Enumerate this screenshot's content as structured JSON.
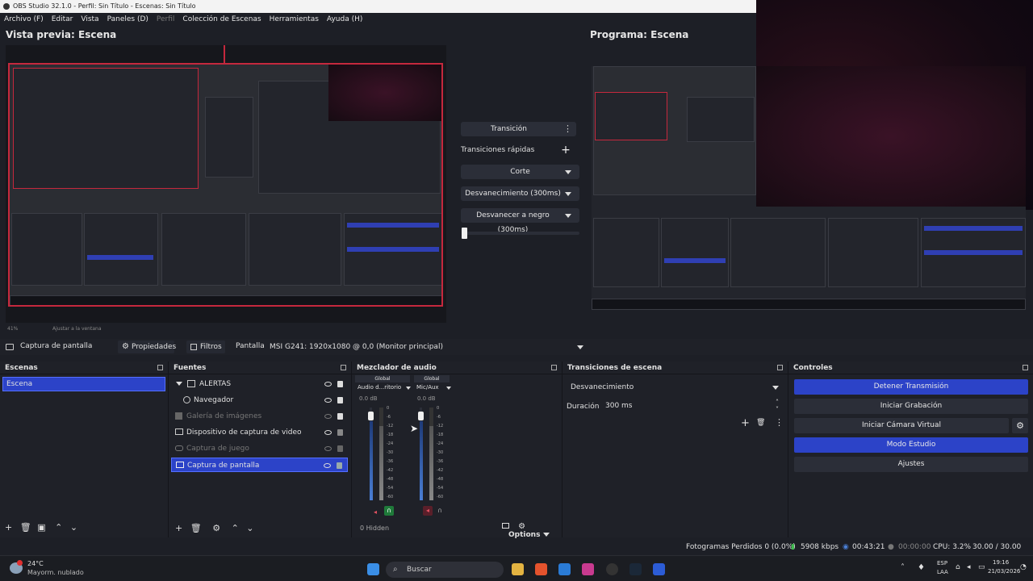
{
  "window": {
    "title": "OBS Studio 32.1.0 - Perfil: Sin Título - Escenas: Sin Título"
  },
  "menu": [
    {
      "label": "Archivo (F)",
      "dim": false
    },
    {
      "label": "Editar",
      "dim": false
    },
    {
      "label": "Vista",
      "dim": false
    },
    {
      "label": "Paneles (D)",
      "dim": false
    },
    {
      "label": "Perfil",
      "dim": true
    },
    {
      "label": "Colección de Escenas",
      "dim": false
    },
    {
      "label": "Herramientas",
      "dim": false
    },
    {
      "label": "Ayuda (H)",
      "dim": false
    }
  ],
  "preview": {
    "title": "Vista previa: Escena",
    "zoom": "41%",
    "fit": "Ajustar a la ventana"
  },
  "program": {
    "title": "Programa: Escena"
  },
  "transitions_center": {
    "transition_label": "Transición",
    "quick_label": "Transiciones rápidas",
    "items": [
      "Corte",
      "Desvanecimiento (300ms)",
      "Desvanecer a negro (300ms)"
    ],
    "tbar_value": 0
  },
  "source_toolbar": {
    "source": "Captura de pantalla",
    "properties": "Propiedades",
    "filters": "Filtros",
    "display_label": "Pantalla",
    "display_value": "MSI G241: 1920x1080 @ 0,0 (Monitor principal)"
  },
  "scenes": {
    "title": "Escenas",
    "items": [
      {
        "label": "Escena",
        "selected": true
      }
    ]
  },
  "sources": {
    "title": "Fuentes",
    "items": [
      {
        "label": "ALERTAS",
        "kind": "group",
        "visible": true,
        "locked": true,
        "selected": false
      },
      {
        "label": "Navegador",
        "kind": "browser",
        "visible": true,
        "locked": true,
        "selected": false
      },
      {
        "label": "Galería de imágenes",
        "kind": "image",
        "visible": false,
        "locked": true,
        "selected": false
      },
      {
        "label": "Dispositivo de captura de video",
        "kind": "camera",
        "visible": true,
        "locked": false,
        "selected": false
      },
      {
        "label": "Captura de juego",
        "kind": "game",
        "visible": false,
        "locked": false,
        "selected": false
      },
      {
        "label": "Captura de pantalla",
        "kind": "display",
        "visible": true,
        "locked": false,
        "selected": true
      }
    ]
  },
  "mixer": {
    "title": "Mezclador de audio",
    "channels": [
      {
        "global": "Global",
        "name": "Audio d...ritorio",
        "db": "0.0 dB",
        "volume": 0.95
      },
      {
        "global": "Global",
        "name": "Mic/Aux",
        "db": "0.0 dB",
        "volume": 0.95
      }
    ],
    "scale": [
      "0",
      "-6",
      "-12",
      "-18",
      "-24",
      "-30",
      "-36",
      "-42",
      "-48",
      "-54",
      "-60"
    ],
    "hidden": "0 Hidden",
    "options": "Options"
  },
  "scene_transitions": {
    "title": "Transiciones de escena",
    "selected": "Desvanecimiento",
    "duration_label": "Duración",
    "duration": "300 ms"
  },
  "controls": {
    "title": "Controles",
    "buttons": [
      {
        "label": "Detener Transmisión",
        "active": true
      },
      {
        "label": "Iniciar Grabación",
        "active": false
      },
      {
        "label": "Iniciar Cámara Virtual",
        "active": false
      },
      {
        "label": "Modo Estudio",
        "active": true
      },
      {
        "label": "Ajustes",
        "active": false
      }
    ]
  },
  "status": {
    "dropped": "Fotogramas Perdidos 0 (0.0%)",
    "bitrate": "5908 kbps",
    "live_time": "00:43:21",
    "rec_time": "00:00:00",
    "cpu": "CPU: 3.2%",
    "fps": "30.00 / 30.00 FPS"
  },
  "taskbar": {
    "weather_temp": "24°C",
    "weather_desc": "Mayorm. nublado",
    "search": "Buscar",
    "lang1": "ESP",
    "lang2": "LAA",
    "time": "19:16",
    "date": "21/03/2026"
  },
  "colors": {
    "accent": "#2c43c8",
    "selection_border": "#c5283d",
    "live": "#3fb950"
  }
}
